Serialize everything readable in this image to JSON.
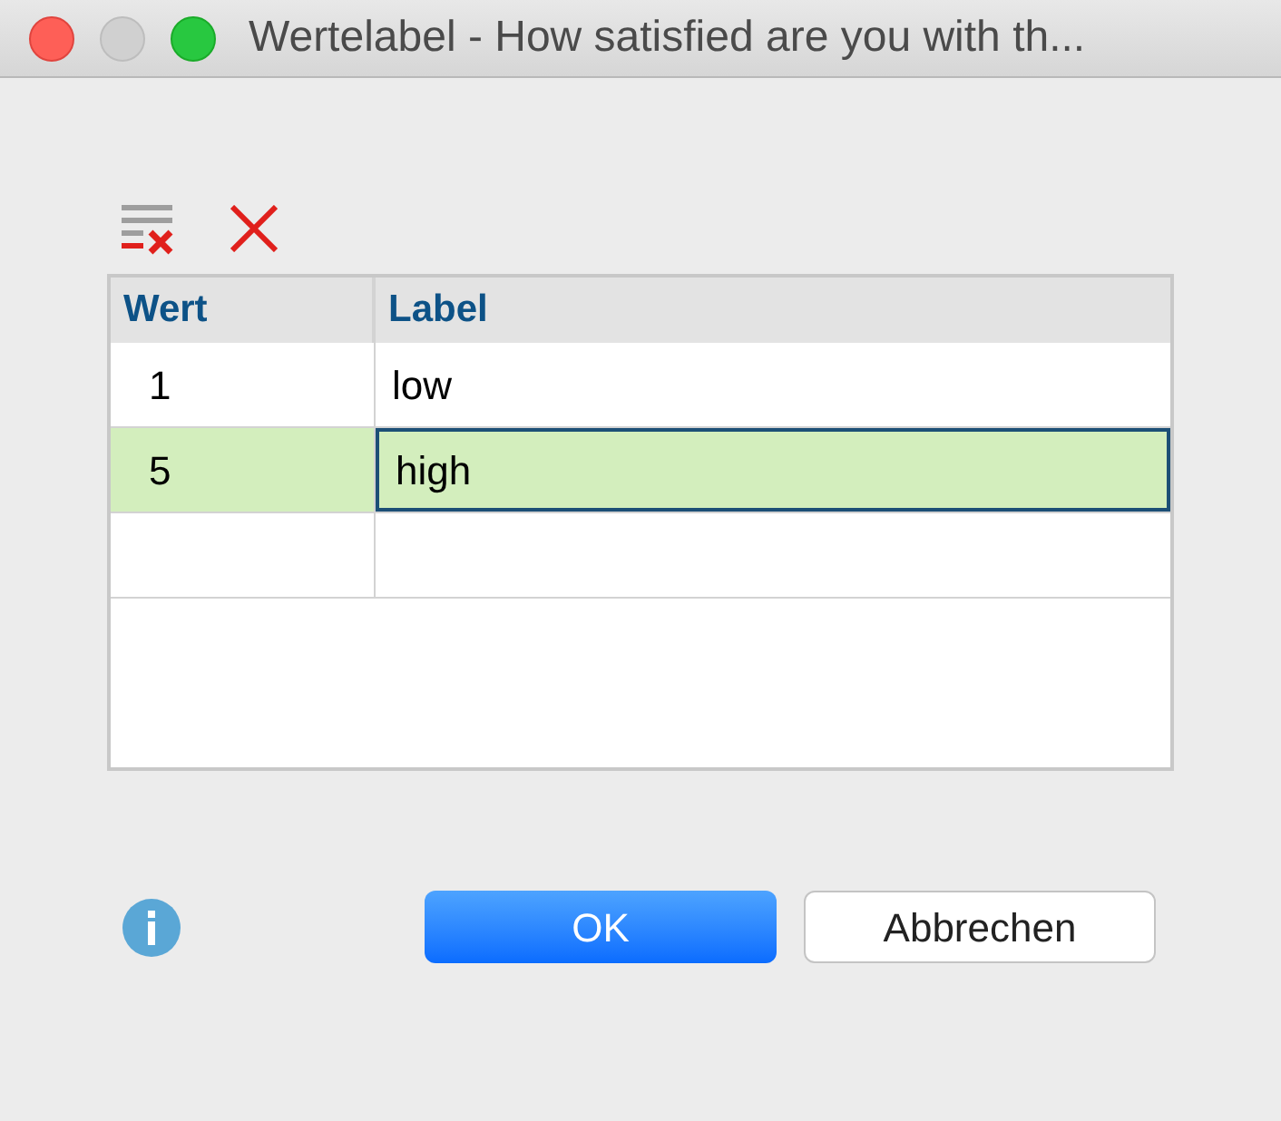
{
  "window": {
    "title": "Wertelabel - How satisfied are you with th..."
  },
  "table": {
    "columns": [
      "Wert",
      "Label"
    ],
    "rows": [
      {
        "value": "1",
        "label": "low",
        "selected": false
      },
      {
        "value": "5",
        "label": "high",
        "selected": true
      }
    ]
  },
  "buttons": [
    {
      "label": "OK",
      "kind": "primary"
    },
    {
      "label": "Abbrechen",
      "kind": "secondary"
    }
  ]
}
